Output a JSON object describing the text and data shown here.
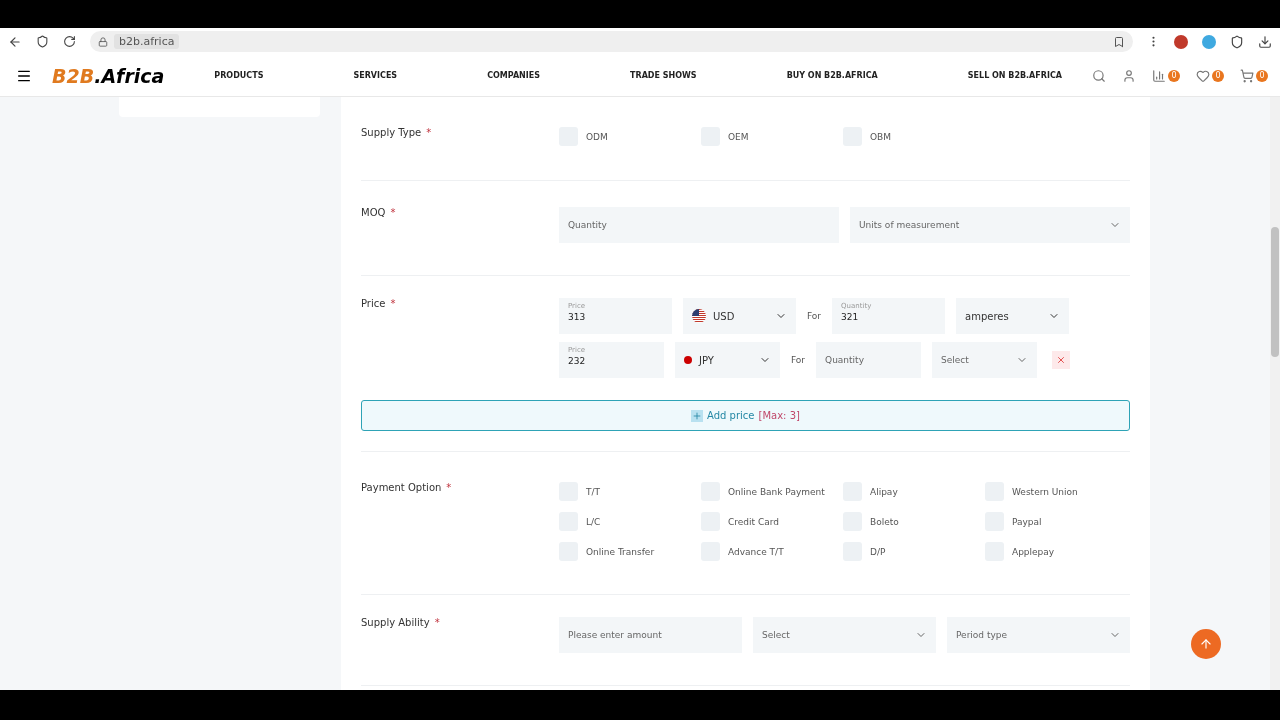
{
  "browser": {
    "url": "b2b.africa"
  },
  "header": {
    "logo_accent": "B2B",
    "logo_rest": ".Africa",
    "nav": [
      "PRODUCTS",
      "SERVICES",
      "COMPANIES",
      "TRADE SHOWS",
      "BUY ON B2B.AFRICA",
      "SELL ON B2B.AFRICA"
    ],
    "counters": [
      {
        "kind": "compare",
        "count": "0"
      },
      {
        "kind": "wishlist",
        "count": "0"
      },
      {
        "kind": "cart",
        "count": "0"
      }
    ]
  },
  "form": {
    "supply_type": {
      "label": "Supply Type",
      "required_mark": "*",
      "options": [
        {
          "label": "ODM",
          "checked": false
        },
        {
          "label": "OEM",
          "checked": false
        },
        {
          "label": "OBM",
          "checked": false
        }
      ]
    },
    "moq": {
      "label": "MOQ",
      "required_mark": "*",
      "quantity_placeholder": "Quantity",
      "unit_placeholder": "Units of measurement"
    },
    "price": {
      "label": "Price",
      "required_mark": "*",
      "rows": [
        {
          "price_label": "Price",
          "price": "313",
          "kind": "us",
          "currency": "USD",
          "for": "For",
          "quantity_label": "Quantity",
          "quantity": "321",
          "unit": "amperes",
          "unit_chosen": true,
          "removable": false
        },
        {
          "price_label": "Price",
          "price": "232",
          "kind": "jp",
          "currency": "JPY",
          "for": "For",
          "quantity_placeholder": "Quantity",
          "unit": "Select",
          "unit_chosen": false,
          "removable": true
        }
      ],
      "add_button": "Add price",
      "add_limit": "[Max: 3]"
    },
    "payment": {
      "label": "Payment Option",
      "required_mark": "*",
      "options": [
        {
          "label": "T/T",
          "checked": false
        },
        {
          "label": "Online Bank Payment",
          "checked": false
        },
        {
          "label": "Alipay",
          "checked": false
        },
        {
          "label": "Western Union",
          "checked": false
        },
        {
          "label": "L/C",
          "checked": false
        },
        {
          "label": "Credit Card",
          "checked": false
        },
        {
          "label": "Boleto",
          "checked": false
        },
        {
          "label": "Paypal",
          "checked": false
        },
        {
          "label": "Online Transfer",
          "checked": false
        },
        {
          "label": "Advance T/T",
          "checked": false
        },
        {
          "label": "D/P",
          "checked": false
        },
        {
          "label": "Applepay",
          "checked": false
        }
      ]
    },
    "supply_ability": {
      "label": "Supply Ability",
      "required_mark": "*",
      "amount_placeholder": "Please enter amount",
      "unit_placeholder": "Select",
      "period_placeholder": "Period type"
    }
  }
}
